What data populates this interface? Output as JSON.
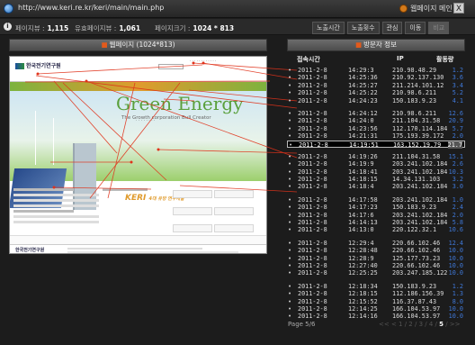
{
  "window": {
    "url": "http://www.keri.re.kr/keri/main/main.php",
    "home_label": "웹페이지 메인",
    "close_label": "X"
  },
  "stats": {
    "page_views_label": "페이지뷰 :",
    "page_views_value": "1,115",
    "unique_views_label": "유효페이지뷰 :",
    "unique_views_value": "1,061",
    "page_size_label": "페이지크기 :",
    "page_size_value": "1024 * 813",
    "tabs": [
      "노출시간",
      "노출횟수",
      "관심",
      "이동",
      "비교"
    ]
  },
  "preview": {
    "header_label": "웹페이지 (1024*813)",
    "site_logo": "한국전기연구원",
    "banner_title": "Green Energy",
    "banner_subtitle": "The Growth corporation Bull Creator",
    "keri_logo": "KERI",
    "keri_logo_suffix": "4대 유망 연구개발",
    "footer_logo": "한국전기연구원"
  },
  "visits": {
    "header_label": "방문자 정보",
    "columns": [
      "접속시간",
      "IP",
      "활동량"
    ],
    "groups": [
      [
        {
          "date": "2011-2-8",
          "time": "14:29:3",
          "ip": "210.98.48.29",
          "level": "1.2"
        },
        {
          "date": "2011-2-8",
          "time": "14:25:36",
          "ip": "210.92.137.130",
          "level": "3.6"
        },
        {
          "date": "2011-2-8",
          "time": "14:25:27",
          "ip": "211.214.101.12",
          "level": "3.4"
        },
        {
          "date": "2011-2-8",
          "time": "14:25:22",
          "ip": "210.98.6.211",
          "level": "5.2"
        },
        {
          "date": "2011-2-8",
          "time": "14:24:23",
          "ip": "150.183.9.23",
          "level": "4.1"
        }
      ],
      [
        {
          "date": "2011-2-8",
          "time": "14:24:12",
          "ip": "210.98.6.211",
          "level": "12.6"
        },
        {
          "date": "2011-2-8",
          "time": "14:24:0",
          "ip": "211.104.31.58",
          "level": "20.9"
        },
        {
          "date": "2011-2-8",
          "time": "14:23:56",
          "ip": "112.170.114.184",
          "level": "5.7"
        },
        {
          "date": "2011-2-8",
          "time": "14:21:31",
          "ip": "175.193.39.172",
          "level": "2.0"
        },
        {
          "date": "2011-2-8",
          "time": "14:19:51",
          "ip": "163.152.19.79",
          "level": "21.7",
          "selected": true
        }
      ],
      [
        {
          "date": "2011-2-8",
          "time": "14:19:26",
          "ip": "211.104.31.58",
          "level": "15.1"
        },
        {
          "date": "2011-2-8",
          "time": "14:19:9",
          "ip": "203.241.102.184",
          "level": "2.6"
        },
        {
          "date": "2011-2-8",
          "time": "14:18:41",
          "ip": "203.241.102.184",
          "level": "10.3"
        },
        {
          "date": "2011-2-8",
          "time": "14:18:15",
          "ip": "14.34.131.103",
          "level": "3.2"
        },
        {
          "date": "2011-2-8",
          "time": "14:18:4",
          "ip": "203.241.102.184",
          "level": "3.0"
        }
      ],
      [
        {
          "date": "2011-2-8",
          "time": "14:17:58",
          "ip": "203.241.102.184",
          "level": "1.0"
        },
        {
          "date": "2011-2-8",
          "time": "14:17:23",
          "ip": "150.183.9.23",
          "level": "2.4"
        },
        {
          "date": "2011-2-8",
          "time": "14:17:6",
          "ip": "203.241.102.184",
          "level": "2.0"
        },
        {
          "date": "2011-2-8",
          "time": "14:14:13",
          "ip": "203.241.102.184",
          "level": "5.8"
        },
        {
          "date": "2011-2-8",
          "time": "14:13:0",
          "ip": "220.122.32.1",
          "level": "10.6"
        }
      ],
      [
        {
          "date": "2011-2-8",
          "time": "12:29:4",
          "ip": "220.66.102.46",
          "level": "12.4"
        },
        {
          "date": "2011-2-8",
          "time": "12:28:48",
          "ip": "220.66.102.46",
          "level": "10.0"
        },
        {
          "date": "2011-2-8",
          "time": "12:28:9",
          "ip": "125.177.73.23",
          "level": "10.0"
        },
        {
          "date": "2011-2-8",
          "time": "12:27:40",
          "ip": "220.66.102.46",
          "level": "10.0"
        },
        {
          "date": "2011-2-8",
          "time": "12:25:25",
          "ip": "203.247.185.122",
          "level": "10.0"
        }
      ],
      [
        {
          "date": "2011-2-8",
          "time": "12:18:34",
          "ip": "150.183.9.23",
          "level": "1.2"
        },
        {
          "date": "2011-2-8",
          "time": "12:18:15",
          "ip": "112.186.156.39",
          "level": "1.3"
        },
        {
          "date": "2011-2-8",
          "time": "12:15:52",
          "ip": "116.37.87.43",
          "level": "8.0"
        },
        {
          "date": "2011-2-8",
          "time": "12:14:25",
          "ip": "166.104.53.97",
          "level": "10.0"
        },
        {
          "date": "2011-2-8",
          "time": "12:14:16",
          "ip": "166.104.53.97",
          "level": "10.0"
        }
      ]
    ],
    "pager_label": "Page 5/6",
    "pager_links": "<< < 1 / 2 / 3 / 4 / 5 / >>",
    "pager_current": "5"
  },
  "colors": {
    "accent": "#e25a1c",
    "level_blue": "#3f78d8",
    "flow_lines": "#e0331b"
  }
}
